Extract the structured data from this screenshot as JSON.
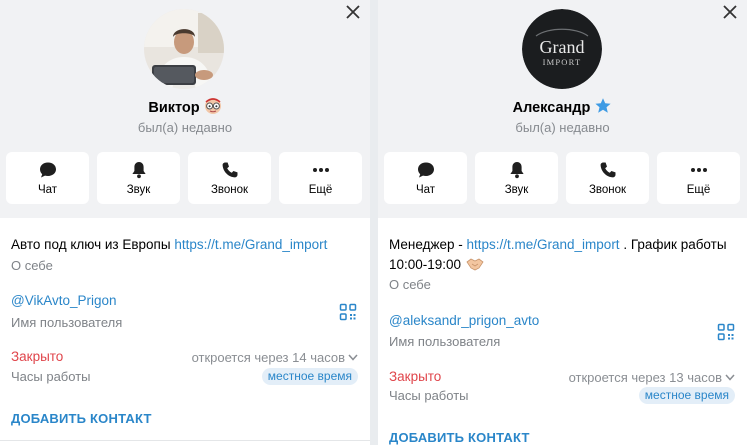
{
  "left_profile": {
    "name": "Виктор",
    "name_badge_icon": "face-with-glasses-emoji",
    "status": "был(а) недавно",
    "actions": [
      {
        "label": "Чат",
        "icon": "chat-bubble-icon"
      },
      {
        "label": "Звук",
        "icon": "bell-icon"
      },
      {
        "label": "Звонок",
        "icon": "phone-icon"
      },
      {
        "label": "Ещё",
        "icon": "more-dots-icon"
      }
    ],
    "bio": {
      "text": "Авто под ключ из Европы ",
      "link": "https://t.me/Grand_import",
      "label": "О себе"
    },
    "username": {
      "value": "@VikAvto_Prigon",
      "label": "Имя пользователя"
    },
    "hours": {
      "state": "Закрыто",
      "opens": "откроется через 14 часов",
      "label": "Часы работы",
      "timezone_pill": "местное время"
    },
    "add_contact": "ДОБАВИТЬ КОНТАКТ"
  },
  "right_profile": {
    "name": "Александр",
    "name_badge_icon": "premium-star-icon",
    "status": "был(а) недавно",
    "avatar_text": {
      "line1": "Grand",
      "line2": "IMPORT"
    },
    "actions": [
      {
        "label": "Чат",
        "icon": "chat-bubble-icon"
      },
      {
        "label": "Звук",
        "icon": "bell-icon"
      },
      {
        "label": "Звонок",
        "icon": "phone-icon"
      },
      {
        "label": "Ещё",
        "icon": "more-dots-icon"
      }
    ],
    "bio": {
      "text_before": "Менеджер - ",
      "link": "https://t.me/Grand_import",
      "text_after": " . График работы",
      "line2": "10:00-19:00",
      "label": "О себе"
    },
    "username": {
      "value": "@aleksandr_prigon_avto",
      "label": "Имя пользователя"
    },
    "hours": {
      "state": "Закрыто",
      "opens": "откроется через 13 часов",
      "label": "Часы работы",
      "timezone_pill": "местное время"
    },
    "add_contact": "ДОБАВИТЬ КОНТАКТ"
  },
  "colors": {
    "link": "#2a86c9",
    "closed": "#e0454b",
    "header_bg": "#f1f2f4",
    "premium_star": "#3e9be4"
  }
}
